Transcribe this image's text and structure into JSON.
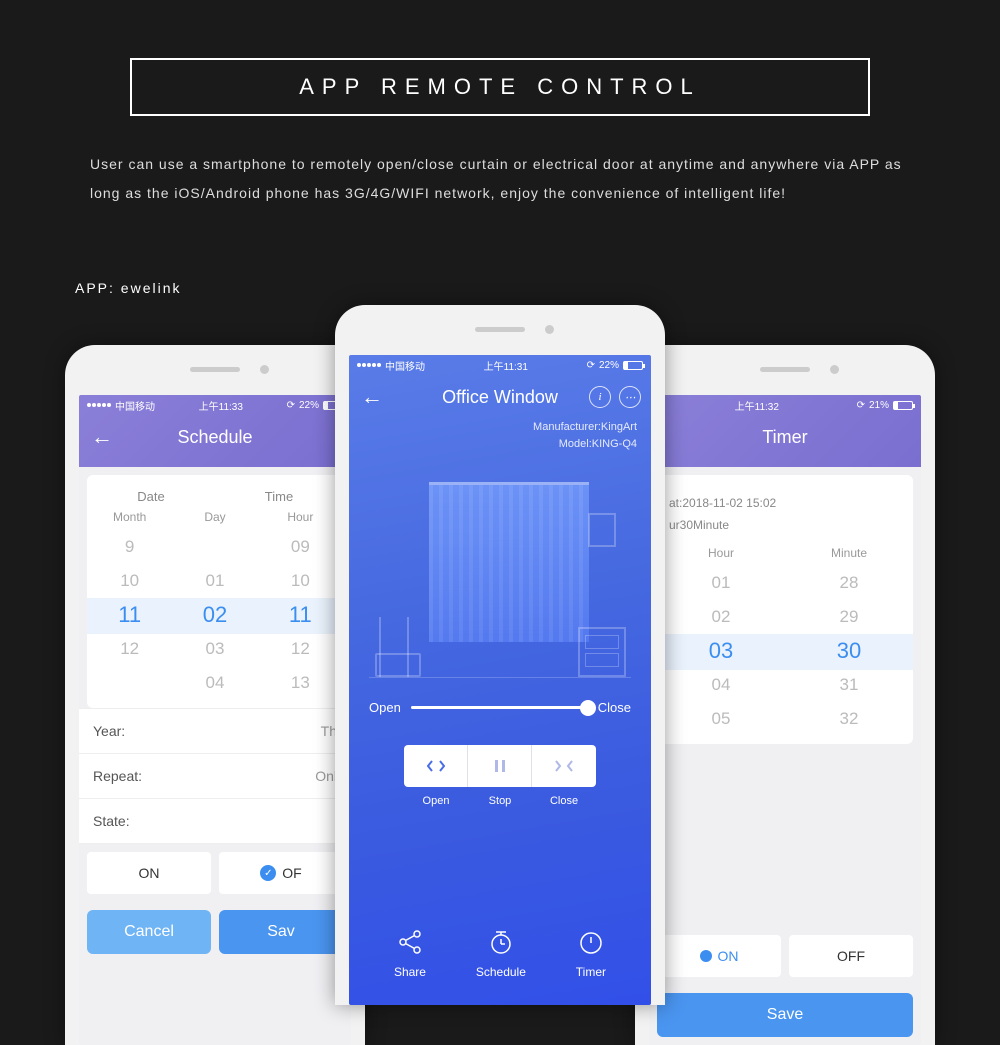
{
  "banner": {
    "title": "APP REMOTE CONTROL",
    "desc": "User can use a smartphone to remotely open/close curtain or electrical door at anytime and anywhere via APP as long as the iOS/Android phone has 3G/4G/WIFI network, enjoy the convenience of intelligent life!",
    "app_label": "APP: ewelink"
  },
  "left": {
    "status": {
      "carrier": "中国移动",
      "time": "上午11:33",
      "battery": "22%"
    },
    "title": "Schedule",
    "cols": {
      "date": "Date",
      "time": "Time"
    },
    "subcols": {
      "month": "Month",
      "day": "Day",
      "hour": "Hour"
    },
    "picker": {
      "month": [
        "9",
        "10",
        "11",
        "12",
        ""
      ],
      "day": [
        "",
        "01",
        "02",
        "03",
        "04"
      ],
      "hour": [
        "09",
        "10",
        "11",
        "12",
        "13"
      ]
    },
    "rows": {
      "year_label": "Year:",
      "year_value": "Th",
      "repeat_label": "Repeat:",
      "repeat_value": "Onl",
      "state_label": "State:"
    },
    "state": {
      "on": "ON",
      "off": "OF"
    },
    "footer": {
      "cancel": "Cancel",
      "save": "Sav"
    }
  },
  "center": {
    "status": {
      "carrier": "中国移动",
      "time": "上午11:31",
      "battery": "22%"
    },
    "title": "Office Window",
    "meta": {
      "manufacturer_label": "Manufacturer:",
      "manufacturer": "KingArt",
      "model_label": "Model:",
      "model": "KING-Q4"
    },
    "slider": {
      "open": "Open",
      "close": "Close"
    },
    "controls": {
      "open": "Open",
      "stop": "Stop",
      "close": "Close"
    },
    "bottom": {
      "share": "Share",
      "schedule": "Schedule",
      "timer": "Timer"
    }
  },
  "right": {
    "status": {
      "time": "上午11:32",
      "battery": "21%"
    },
    "title": "Timer",
    "meta": {
      "at_label": "at:",
      "at_value": "2018-11-02 15:02",
      "dur": "ur30Minute"
    },
    "subcols": {
      "hour": "Hour",
      "minute": "Minute"
    },
    "picker": {
      "hour": [
        "01",
        "02",
        "03",
        "04",
        "05"
      ],
      "minute": [
        "28",
        "29",
        "30",
        "31",
        "32"
      ]
    },
    "state": {
      "on": "ON",
      "off": "OFF"
    },
    "footer": {
      "save": "Save"
    }
  }
}
